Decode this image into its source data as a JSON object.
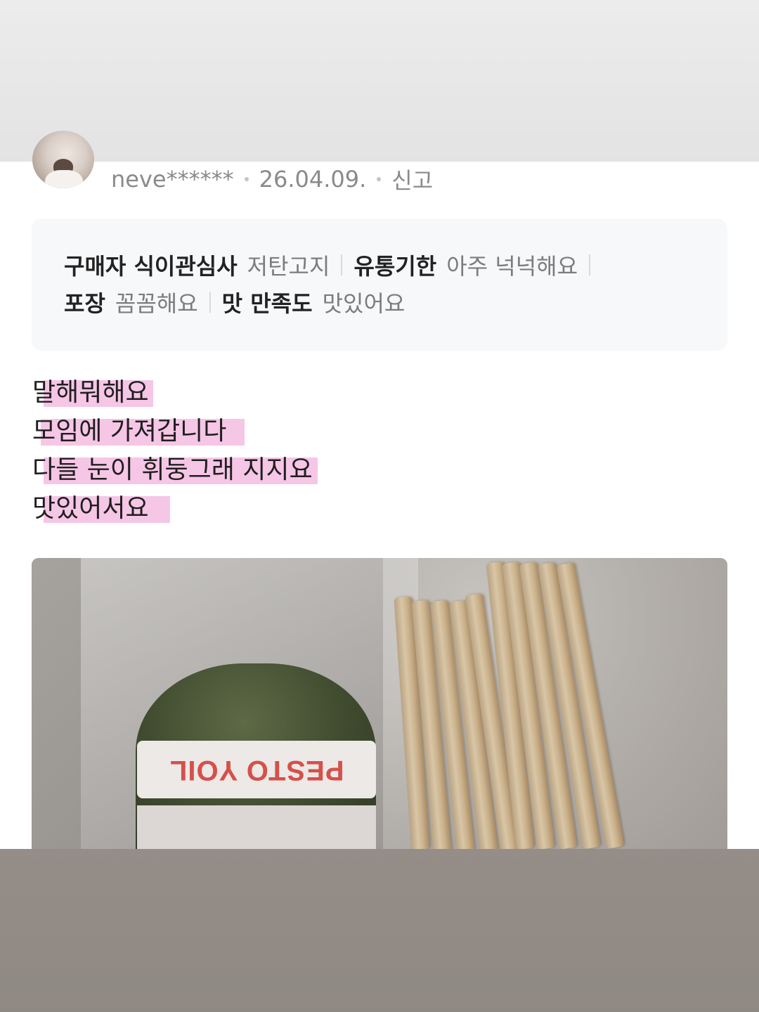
{
  "review": {
    "username": "neve******",
    "date": "26.04.09.",
    "report_label": "신고"
  },
  "attributes": [
    {
      "label": "구매자 식이관심사",
      "value": "저탄고지"
    },
    {
      "label": "유통기한",
      "value": "아주 넉넉해요"
    },
    {
      "label": "포장",
      "value": "꼼꼼해요"
    },
    {
      "label": "맛 만족도",
      "value": "맛있어요"
    }
  ],
  "body_lines": [
    "말해뭐해요",
    "모임에 가져갑니다",
    "다들 눈이 휘둥그래 지지요",
    "맛있어서요"
  ],
  "photo": {
    "jar_label": "PESTO YOIL"
  },
  "colors": {
    "highlight": "#f6c6e6",
    "attr_box_bg": "#f7f8fa",
    "meta_text": "#8a8a8a"
  }
}
